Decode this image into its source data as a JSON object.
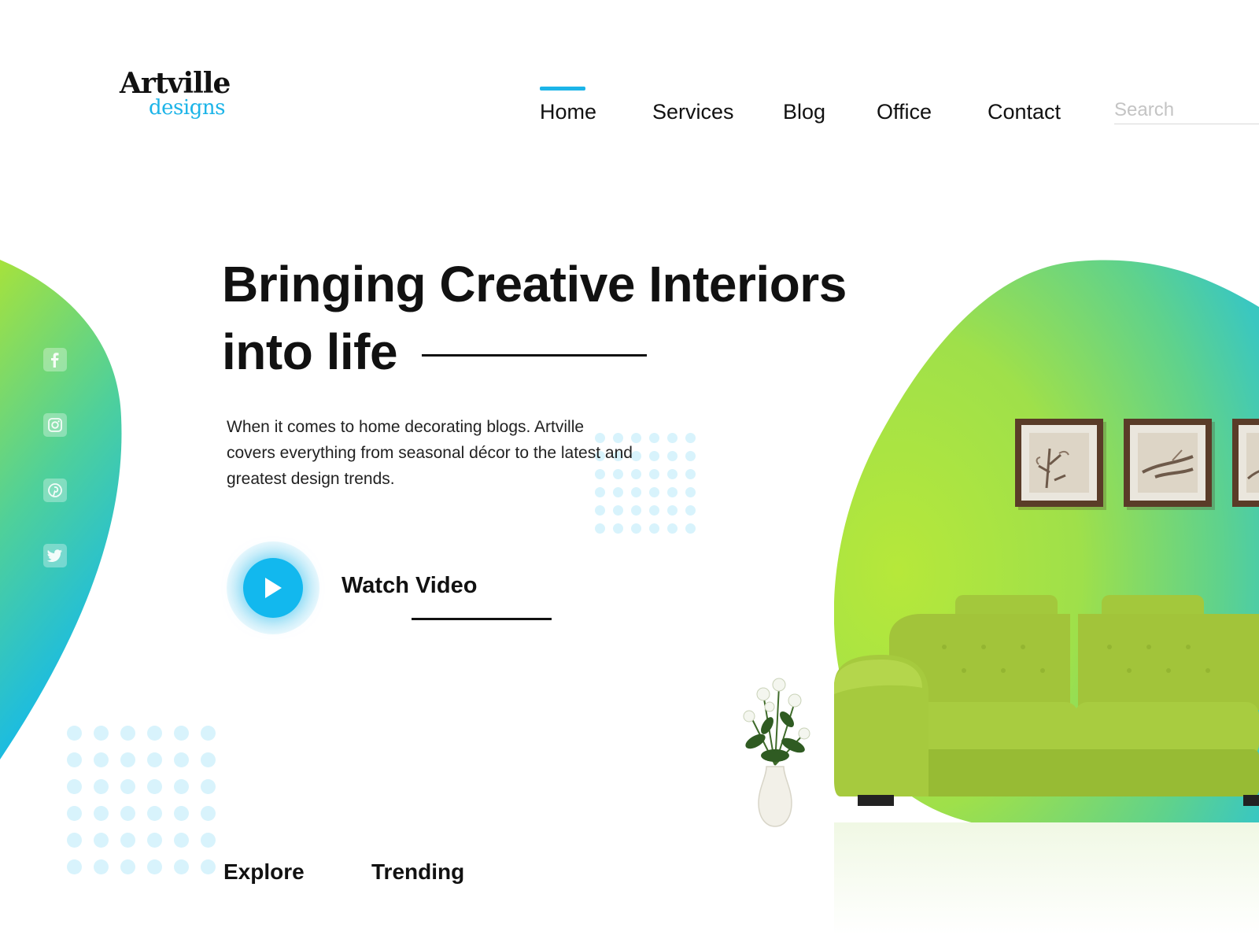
{
  "brand": {
    "name_top": "Artville",
    "name_bottom": "designs",
    "accent_color": "#1cb4e8"
  },
  "nav": {
    "items": [
      {
        "label": "Home",
        "active": true
      },
      {
        "label": "Services",
        "active": false
      },
      {
        "label": "Blog",
        "active": false
      },
      {
        "label": "Office",
        "active": false
      },
      {
        "label": "Contact",
        "active": false
      }
    ],
    "search_placeholder": "Search"
  },
  "hero": {
    "title_line1": "Bringing Creative Interiors",
    "title_line2": "into life",
    "description": "When it comes to home decorating blogs. Artville covers everything from seasonal décor to the latest and greatest design trends.",
    "watch_label": "Watch Video"
  },
  "social": [
    {
      "icon": "facebook-icon"
    },
    {
      "icon": "instagram-icon"
    },
    {
      "icon": "pinterest-icon"
    },
    {
      "icon": "twitter-icon"
    }
  ],
  "bottom_tabs": [
    {
      "label": "Explore"
    },
    {
      "label": "Trending"
    }
  ],
  "colors": {
    "blob_green": "#a6e23c",
    "blob_teal": "#3ac7c0",
    "blob_blue": "#12b8ee",
    "sofa": "#9ec83a",
    "dots": "#d8f3fc"
  }
}
